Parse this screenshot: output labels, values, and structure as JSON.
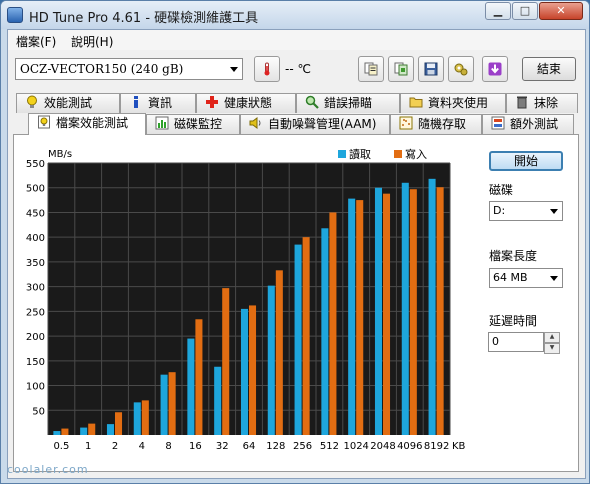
{
  "window": {
    "title": "HD Tune Pro 4.61 - 硬碟檢測維護工具",
    "min_label": "▁",
    "max_label": "□",
    "close_label": "✕"
  },
  "menu": [
    {
      "label": "檔案(F)"
    },
    {
      "label": "說明(H)"
    }
  ],
  "toolbar": {
    "drive": "OCZ-VECTOR150 (240 gB)",
    "temperature": "-- ℃",
    "exit_label": "結束",
    "icons": [
      "copy-text-icon",
      "copy-screenshot-icon",
      "save-icon",
      "options-icon",
      "download-icon"
    ]
  },
  "tabs_row1": [
    {
      "label": "效能測試",
      "icon": "lightbulb-icon"
    },
    {
      "label": "資訊",
      "icon": "info-icon"
    },
    {
      "label": "健康狀態",
      "icon": "health-cross-icon"
    },
    {
      "label": "錯誤掃瞄",
      "icon": "magnifier-icon"
    },
    {
      "label": "資料夾使用",
      "icon": "folder-icon"
    },
    {
      "label": "抹除",
      "icon": "trash-icon"
    }
  ],
  "tabs_row2": [
    {
      "label": "檔案效能測試",
      "icon": "file-benchmark-icon",
      "active": true
    },
    {
      "label": "磁碟監控",
      "icon": "disk-monitor-icon"
    },
    {
      "label": "自動噪聲管理(AAM)",
      "icon": "speaker-icon"
    },
    {
      "label": "隨機存取",
      "icon": "random-access-icon"
    },
    {
      "label": "額外測試",
      "icon": "extra-tests-icon"
    }
  ],
  "side": {
    "start_label": "開始",
    "disk_label": "磁碟",
    "disk_value": "D:",
    "file_length_label": "檔案長度",
    "file_length_value": "64 MB",
    "delay_label": "延遲時間",
    "delay_value": "0"
  },
  "chart_data": {
    "type": "bar",
    "ylabel": "MB/s",
    "xunit": "KB",
    "ylim": [
      0,
      550
    ],
    "yticks": [
      50,
      100,
      150,
      200,
      250,
      300,
      350,
      400,
      450,
      500,
      550
    ],
    "categories": [
      "0.5",
      "1",
      "2",
      "4",
      "8",
      "16",
      "32",
      "64",
      "128",
      "256",
      "512",
      "1024",
      "2048",
      "4096",
      "8192"
    ],
    "series": [
      {
        "name": "讀取",
        "color": "#1ea6dc",
        "values": [
          8,
          15,
          22,
          66,
          122,
          195,
          138,
          255,
          302,
          385,
          418,
          478,
          500,
          510,
          518
        ]
      },
      {
        "name": "寫入",
        "color": "#e26d12",
        "values": [
          13,
          23,
          46,
          70,
          127,
          234,
          297,
          262,
          333,
          400,
          450,
          475,
          488,
          497,
          501
        ]
      }
    ],
    "legend": "top-right",
    "grid": true,
    "background": "#1a1a1a"
  },
  "watermark": "coolaler.com"
}
